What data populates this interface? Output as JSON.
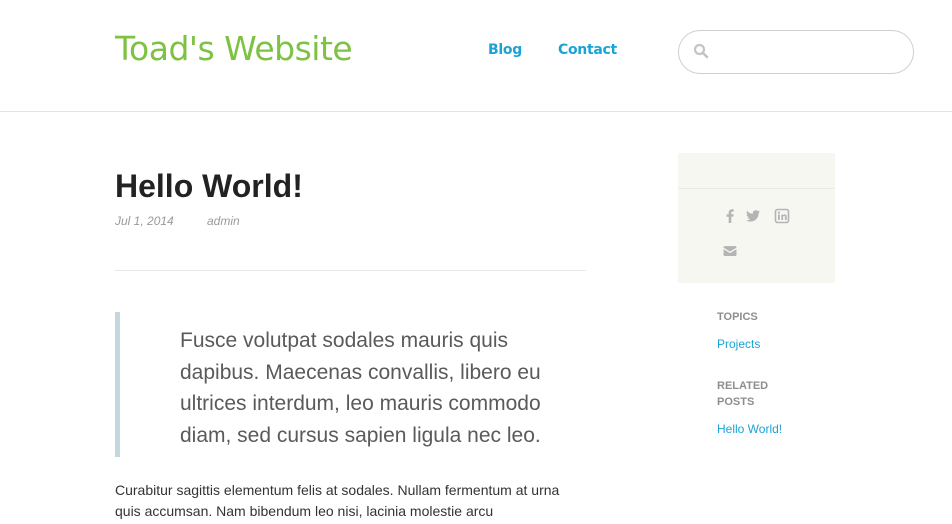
{
  "header": {
    "site_title": "Toad's Website",
    "nav": [
      "Blog",
      "Contact"
    ],
    "search": {
      "placeholder": "",
      "value": ""
    }
  },
  "post": {
    "title": "Hello World!",
    "date": "Jul 1, 2014",
    "author": "admin",
    "blockquote": "Fusce volutpat sodales mauris quis dapibus. Maecenas convallis, libero eu ultrices interdum, leo mauris commodo diam, sed cursus sapien ligula nec leo.",
    "body": "Curabitur sagittis elementum felis at sodales. Nullam fermentum at urna quis accumsan. Nam bibendum leo nisi, lacinia molestie arcu"
  },
  "sidebar": {
    "share_icons": [
      "facebook-icon",
      "twitter-icon",
      "linkedin-icon",
      "email-icon"
    ],
    "topics_heading": "TOPICS",
    "topics": [
      "Projects"
    ],
    "related_heading": "RELATED POSTS",
    "related": [
      "Hello World!"
    ]
  },
  "colors": {
    "brand_green": "#7dc242",
    "link_blue": "#1ba3d6",
    "quote_border": "#c5d7de",
    "share_box_bg": "#f7f7f2"
  }
}
